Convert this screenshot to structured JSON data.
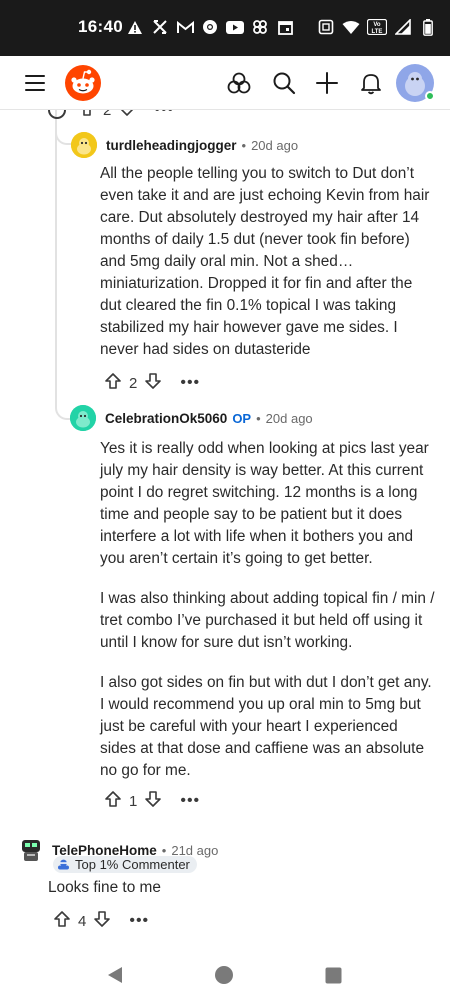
{
  "status_bar": {
    "time": "16:40",
    "left_icons": [
      "warning-icon",
      "x-app-icon",
      "gmail-icon",
      "chrome-icon",
      "youtube-icon",
      "pinwheel-icon",
      "calendar-icon"
    ],
    "right_icons": [
      "screenshot-icon",
      "wifi-icon",
      "volte-icon",
      "signal-icon",
      "battery-icon"
    ],
    "volte_label": "Vo LTE"
  },
  "header": {
    "icons": [
      "menu-icon",
      "reddit-logo",
      "communities-icon",
      "search-icon",
      "create-icon",
      "notifications-icon",
      "user-avatar"
    ],
    "accent": "#ff4500"
  },
  "thread": {
    "parent_partial": {
      "votes": "2"
    },
    "comments": [
      {
        "author": "turdleheadingjogger",
        "op": false,
        "age": "20d ago",
        "body": [
          "All the people telling you to switch to Dut don’t even take it and are just echoing Kevin from hair care. Dut absolutely destroyed my hair after 14 months of daily 1.5 dut (never took fin before) and 5mg daily oral min. Not a shed… miniaturization. Dropped it for fin and after the dut cleared the fin 0.1% topical I was taking stabilized my hair however gave me sides. I never had sides on dutasteride"
        ],
        "votes": "2",
        "avatar_color": "#f2c71a"
      },
      {
        "author": "CelebrationOk5060",
        "op": true,
        "op_label": "OP",
        "age": "20d ago",
        "body": [
          "Yes it is really odd when looking at pics last year july my hair density is way better. At this current point I do regret switching. 12 months is a long time and people say to be patient but it does interfere a lot with life when it bothers you and you aren’t certain it’s going to get better.",
          "I was also thinking about adding topical fin / min / tret combo I’ve purchased it but held off using it until I know for sure dut isn’t working.",
          "I also got sides on fin but with dut I don’t get any. I would recommend you up oral min to 5mg but just be careful with your heart I experienced sides at that dose and caffiene was an absolute no go for me."
        ],
        "votes": "1",
        "avatar_color": "#22d3a7"
      },
      {
        "author": "TelePhoneHome",
        "op": false,
        "age": "21d ago",
        "flair": "Top 1% Commenter",
        "body": [
          "Looks fine to me"
        ],
        "votes": "4",
        "avatar_color": "#2a2a2a"
      }
    ],
    "separator": "•"
  },
  "nav": {
    "icons": [
      "back-icon",
      "home-icon",
      "recents-icon"
    ]
  }
}
